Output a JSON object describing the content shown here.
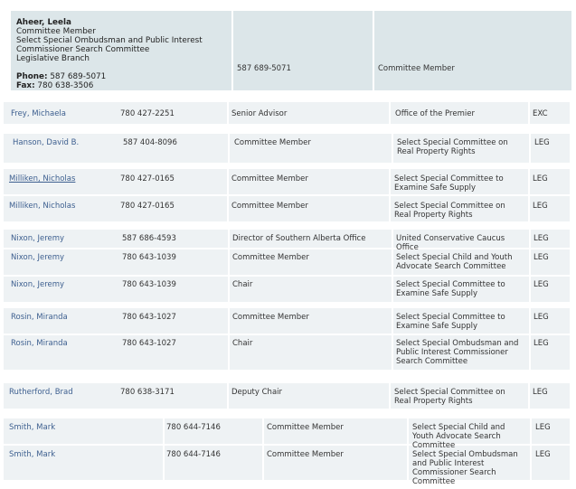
{
  "header_card": {
    "name": "Aheer, Leela",
    "lines": [
      "Committee Member",
      "Select Special Ombudsman and Public Interest",
      "Commissioner Search Committee",
      "Legislative Branch"
    ],
    "phone_label": "Phone:",
    "phone": "587 689-5071",
    "fax_label": "Fax:",
    "fax": "780 638-3506",
    "col2": "587 689-5071",
    "col3": "Committee Member"
  },
  "rows": [
    {
      "name": "Frey, Michaela",
      "phone": "780 427-2251",
      "role": "Senior Advisor",
      "org": "Office of the Premier",
      "branch": "EXC"
    },
    {
      "name": "Hanson, David B.",
      "phone": "587 404-8096",
      "role": "Committee Member",
      "org": "Select Special Committee on Real Property Rights",
      "branch": "LEG"
    },
    {
      "name": "Milliken, Nicholas",
      "phone": "780 427-0165",
      "role": "Committee Member",
      "org": "Select Special Committee to Examine Safe Supply",
      "branch": "LEG"
    },
    {
      "name": "Milliken, Nicholas",
      "phone": "780 427-0165",
      "role": "Committee Member",
      "org": "Select Special Committee on Real Property Rights",
      "branch": "LEG"
    },
    {
      "name": "Nixon, Jeremy",
      "phone": "587 686-4593",
      "role": "Director of Southern Alberta Office",
      "org": "United Conservative Caucus Office",
      "branch": "LEG"
    },
    {
      "name": "Nixon, Jeremy",
      "phone": "780 643-1039",
      "role": "Committee Member",
      "org": "Select Special Child and Youth Advocate Search Committee",
      "branch": "LEG"
    },
    {
      "name": "Nixon, Jeremy",
      "phone": "780 643-1039",
      "role": "Chair",
      "org": "Select Special Committee to Examine Safe Supply",
      "branch": "LEG"
    },
    {
      "name": "Rosin, Miranda",
      "phone": "780 643-1027",
      "role": "Committee Member",
      "org": "Select Special Committee to Examine Safe Supply",
      "branch": "LEG"
    },
    {
      "name": "Rosin, Miranda",
      "phone": "780 643-1027",
      "role": "Chair",
      "org": "Select Special Ombudsman and Public Interest Commissioner Search Committee",
      "branch": "LEG"
    },
    {
      "name": "Rutherford, Brad",
      "phone": "780 638-3171",
      "role": "Deputy Chair",
      "org": "Select Special Committee on Real Property Rights",
      "branch": "LEG"
    },
    {
      "name": "Smith, Mark",
      "phone": "780 644-7146",
      "role": "Committee Member",
      "org": "Select Special Child and Youth Advocate Search Committee",
      "branch": "LEG"
    },
    {
      "name": "Smith, Mark",
      "phone": "780 644-7146",
      "role": "Committee Member",
      "org": "Select Special Ombudsman and Public Interest Commissioner Search Committee",
      "branch": "LEG"
    }
  ]
}
